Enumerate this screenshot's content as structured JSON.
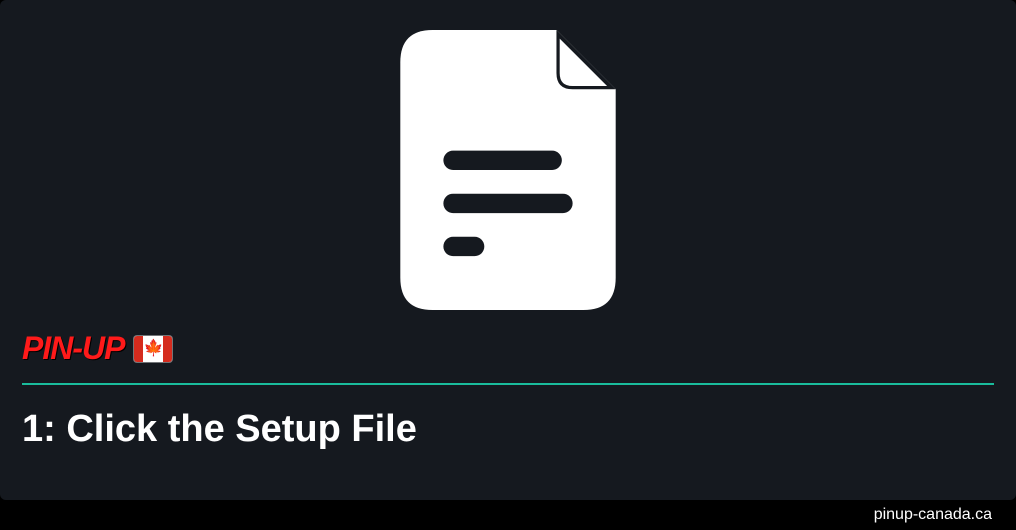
{
  "brand": {
    "name": "PIN-UP",
    "country": "canada"
  },
  "icon": "document-file-icon",
  "step": {
    "number": "1",
    "label": "Click the Setup File",
    "full_title": "1: Click the Setup File"
  },
  "footer": {
    "url": "pinup-canada.ca"
  },
  "colors": {
    "background": "#15191f",
    "accent": "#1abc9c",
    "brand": "#ff1a1a"
  }
}
